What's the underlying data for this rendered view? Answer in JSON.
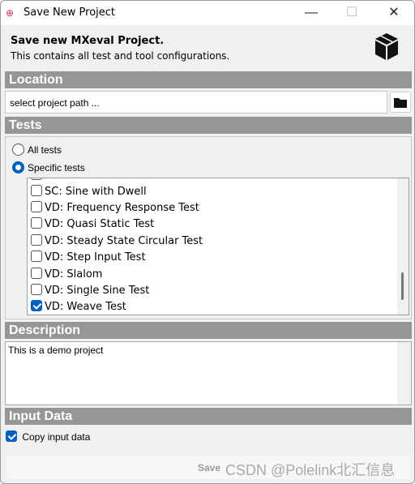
{
  "window": {
    "title": "Save New Project",
    "icon": "app-logo-icon",
    "controls": [
      "minimize-icon",
      "maximize-icon",
      "close-icon"
    ]
  },
  "header": {
    "title": "Save new MXeval Project.",
    "subtitle": "This contains all test and tool configurations.",
    "icon": "package-box-icon"
  },
  "location": {
    "section": "Location",
    "placeholder": "select project path ...",
    "browse_icon": "folder-icon"
  },
  "tests": {
    "section": "Tests",
    "options": [
      {
        "label": "All tests",
        "selected": false
      },
      {
        "label": "Specific tests",
        "selected": true
      }
    ],
    "items": [
      {
        "label": "SC: Sine with Dwell",
        "checked": false
      },
      {
        "label": "VD: Frequency Response Test",
        "checked": false
      },
      {
        "label": "VD: Quasi Static Test",
        "checked": false
      },
      {
        "label": "VD: Steady State Circular Test",
        "checked": false
      },
      {
        "label": "VD: Step Input Test",
        "checked": false
      },
      {
        "label": "VD: Slalom",
        "checked": false
      },
      {
        "label": "VD: Single Sine Test",
        "checked": false
      },
      {
        "label": "VD: Weave Test",
        "checked": true
      }
    ]
  },
  "description": {
    "section": "Description",
    "value": "This is a demo project"
  },
  "input_data": {
    "section": "Input Data",
    "copy_label": "Copy input data",
    "copy_checked": true
  },
  "footer": {
    "save_label": "Save",
    "watermark": "CSDN @Polelink北汇信息"
  },
  "colors": {
    "section_bg": "#969696",
    "accent": "#0060c0"
  }
}
